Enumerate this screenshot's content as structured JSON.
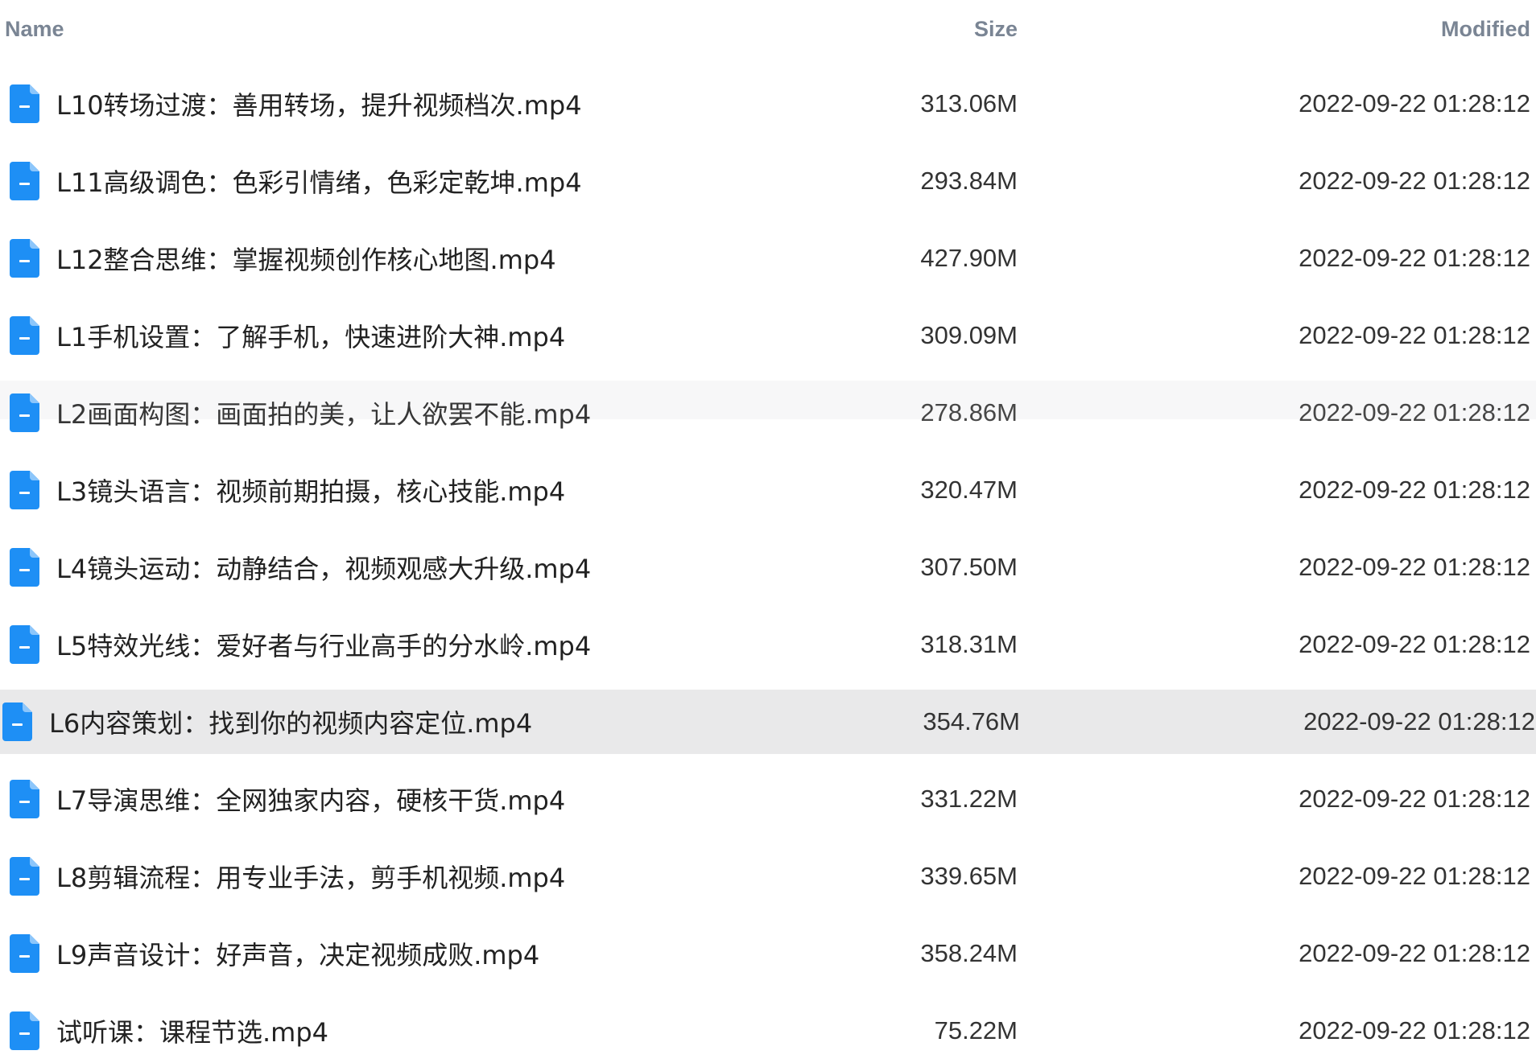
{
  "header": {
    "name": "Name",
    "size": "Size",
    "modified": "Modified"
  },
  "icon": "file-document-icon",
  "accent_color": "#1e8ff5",
  "files": [
    {
      "name": "L10转场过渡：善用转场，提升视频档次.mp4",
      "size": "313.06M",
      "modified": "2022-09-22 01:28:12"
    },
    {
      "name": "L11高级调色：色彩引情绪，色彩定乾坤.mp4",
      "size": "293.84M",
      "modified": "2022-09-22 01:28:12"
    },
    {
      "name": "L12整合思维：掌握视频创作核心地图.mp4",
      "size": "427.90M",
      "modified": "2022-09-22 01:28:12"
    },
    {
      "name": "L1手机设置：了解手机，快速进阶大神.mp4",
      "size": "309.09M",
      "modified": "2022-09-22 01:28:12"
    },
    {
      "name": "L2画面构图：画面拍的美，让人欲罢不能.mp4",
      "size": "278.86M",
      "modified": "2022-09-22 01:28:12"
    },
    {
      "name": "L3镜头语言：视频前期拍摄，核心技能.mp4",
      "size": "320.47M",
      "modified": "2022-09-22 01:28:12"
    },
    {
      "name": "L4镜头运动：动静结合，视频观感大升级.mp4",
      "size": "307.50M",
      "modified": "2022-09-22 01:28:12"
    },
    {
      "name": "L5特效光线：爱好者与行业高手的分水岭.mp4",
      "size": "318.31M",
      "modified": "2022-09-22 01:28:12"
    },
    {
      "name": "L6内容策划：找到你的视频内容定位.mp4",
      "size": "354.76M",
      "modified": "2022-09-22 01:28:12"
    },
    {
      "name": "L7导演思维：全网独家内容，硬核干货.mp4",
      "size": "331.22M",
      "modified": "2022-09-22 01:28:12"
    },
    {
      "name": "L8剪辑流程：用专业手法，剪手机视频.mp4",
      "size": "339.65M",
      "modified": "2022-09-22 01:28:12"
    },
    {
      "name": "L9声音设计：好声音，决定视频成败.mp4",
      "size": "358.24M",
      "modified": "2022-09-22 01:28:12"
    },
    {
      "name": "试听课：课程节选.mp4",
      "size": "75.22M",
      "modified": "2022-09-22 01:28:12"
    }
  ]
}
